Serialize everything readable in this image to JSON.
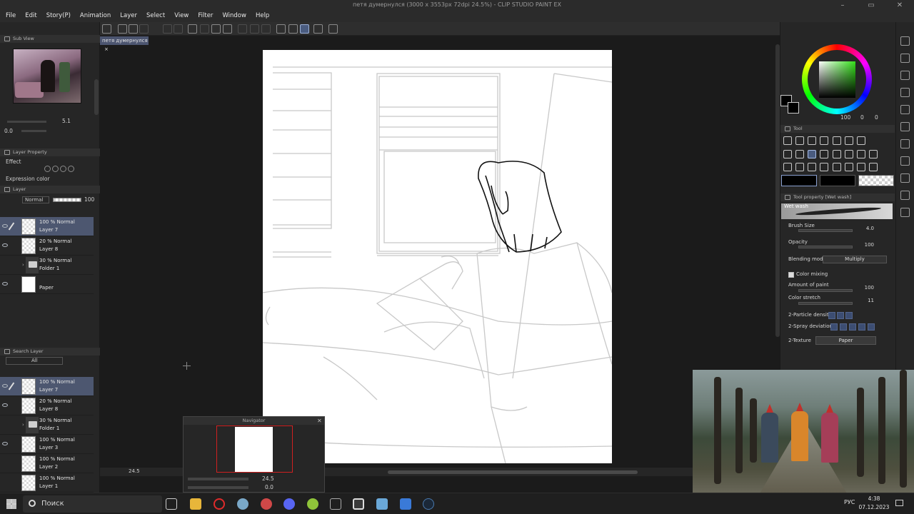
{
  "window": {
    "title": "петя думернулся (3000 x 3553px 72dpi 24.5%) - CLIP STUDIO PAINT EX",
    "controls": {
      "minimize": "–",
      "maximize": "▭",
      "close": "✕"
    }
  },
  "menu": [
    "File",
    "Edit",
    "Story(P)",
    "Animation",
    "Layer",
    "Select",
    "View",
    "Filter",
    "Window",
    "Help"
  ],
  "doc_tab": {
    "label": "петя думернулся",
    "close": "×"
  },
  "subview": {
    "title": "Sub View",
    "zoom": "5.1",
    "rotation": "0.0"
  },
  "layer_property": {
    "title": "Layer Property",
    "effect": "Effect",
    "expression_color": "Expression color"
  },
  "layer_panel": {
    "title": "Layer",
    "blend_mode": "Normal",
    "opacity": "100",
    "layers": [
      {
        "percent": "100 % Normal",
        "name": "Layer 7",
        "selected": true,
        "visible": true,
        "pen": true,
        "thumb": "check"
      },
      {
        "percent": "20 % Normal",
        "name": "Layer 8",
        "selected": false,
        "visible": true,
        "pen": false,
        "thumb": "check"
      },
      {
        "percent": "30 % Normal",
        "name": "Folder 1",
        "selected": false,
        "visible": false,
        "pen": false,
        "thumb": "fold"
      },
      {
        "percent": "",
        "name": "Paper",
        "selected": false,
        "visible": true,
        "pen": false,
        "thumb": "paper"
      }
    ]
  },
  "search_layer": {
    "title": "Search Layer",
    "filter": "All",
    "layers": [
      {
        "percent": "100 % Normal",
        "name": "Layer 7",
        "selected": true,
        "visible": true,
        "pen": true,
        "thumb": "check"
      },
      {
        "percent": "20 % Normal",
        "name": "Layer 8",
        "selected": false,
        "visible": true,
        "pen": false,
        "thumb": "check"
      },
      {
        "percent": "30 % Normal",
        "name": "Folder 1",
        "selected": false,
        "visible": false,
        "pen": false,
        "thumb": "fold"
      },
      {
        "percent": "100 % Normal",
        "name": "Layer 3",
        "selected": false,
        "visible": true,
        "pen": false,
        "thumb": "sketch"
      },
      {
        "percent": "100 % Normal",
        "name": "Layer 2",
        "selected": false,
        "visible": false,
        "pen": false,
        "thumb": "sketch"
      },
      {
        "percent": "100 % Normal",
        "name": "Layer 1",
        "selected": false,
        "visible": false,
        "pen": false,
        "thumb": "sketch"
      }
    ]
  },
  "canvas": {
    "zoom": "24.5"
  },
  "navigator": {
    "title": "Navigator",
    "zoom": "24.5",
    "rotation": "0.0"
  },
  "color": {
    "main": "#000000",
    "sub": "#000000",
    "wheel_hue": "#34e01a",
    "readout": {
      "v1": "100",
      "v2": "0",
      "v3": "0"
    }
  },
  "tool_panel": {
    "title": "Tool"
  },
  "tool_property": {
    "title": "Tool property [Wet wash]",
    "brush_name": "Wet wash",
    "brush_size_label": "Brush Size",
    "brush_size": "4.0",
    "opacity_label": "Opacity",
    "opacity": "100",
    "blending_label": "Blending mode",
    "blending": "Multiply",
    "color_mixing_label": "Color mixing",
    "amount_label": "Amount of paint",
    "amount": "100",
    "stretch_label": "Color stretch",
    "stretch": "11",
    "particle_label": "2-Particle density",
    "spray_label": "2-Spray deviation",
    "texture_label": "2-Texture",
    "texture": "Paper"
  },
  "taskbar": {
    "search": "Поиск",
    "lang": "РУС",
    "time": "4:38",
    "date": "07.12.2023"
  },
  "accent": "#4d5770"
}
